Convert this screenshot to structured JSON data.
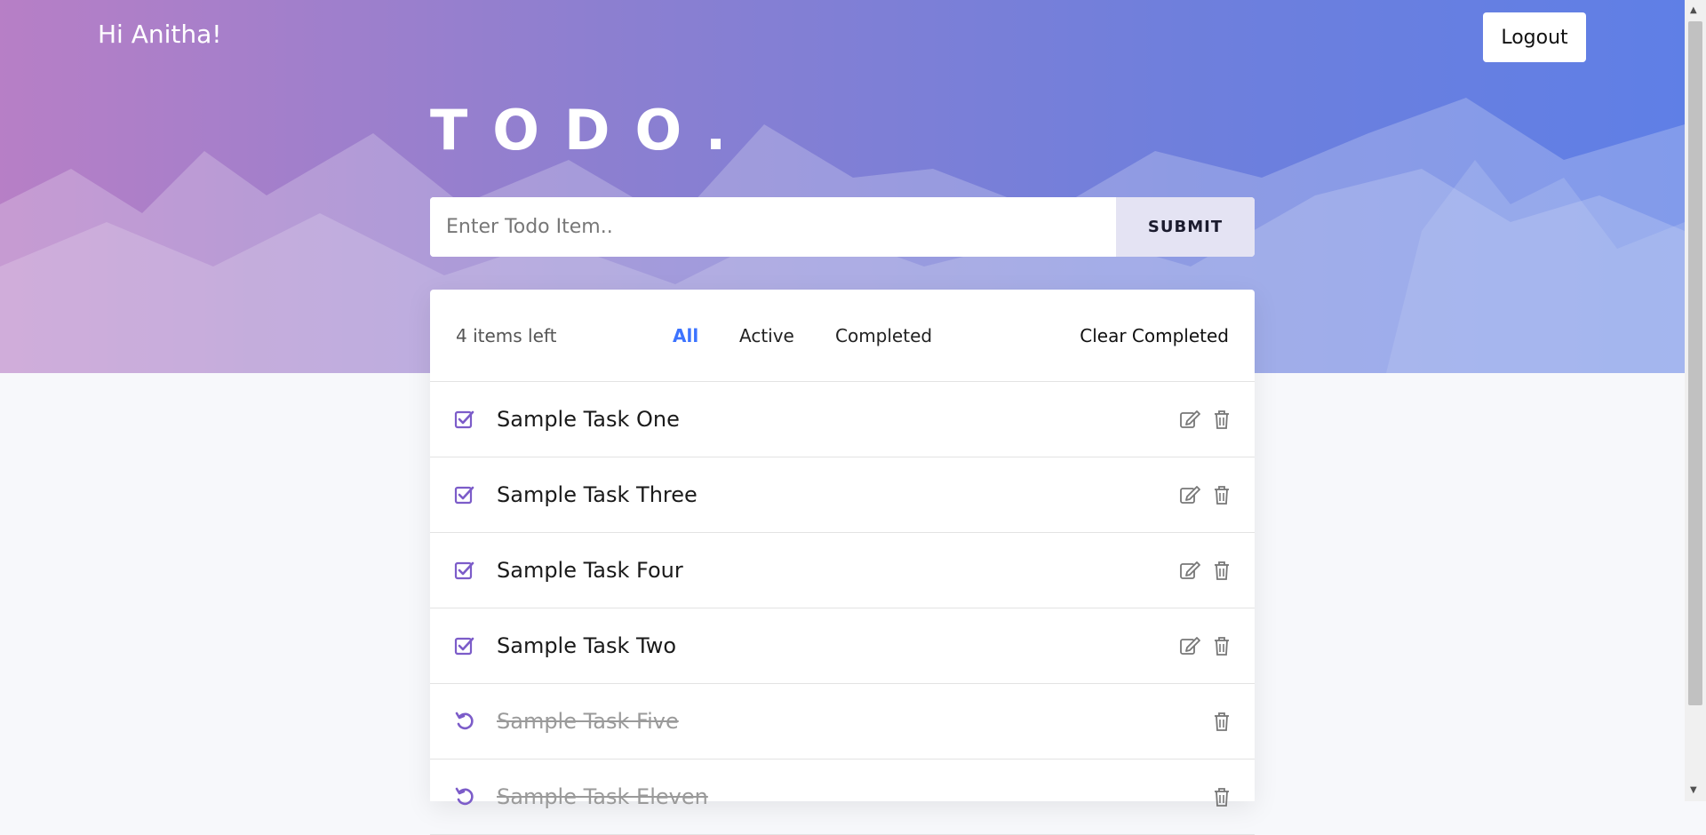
{
  "header": {
    "greeting": "Hi Anitha!",
    "logout_label": "Logout",
    "title": "TODO."
  },
  "entry": {
    "placeholder": "Enter Todo Item..",
    "submit_label": "SUBMIT"
  },
  "filters": {
    "items_left": "4 items left",
    "all": "All",
    "active": "Active",
    "completed": "Completed",
    "clear": "Clear Completed",
    "selected": "All"
  },
  "todos": [
    {
      "text": "Sample Task One",
      "completed": false
    },
    {
      "text": "Sample Task Three",
      "completed": false
    },
    {
      "text": "Sample Task Four",
      "completed": false
    },
    {
      "text": "Sample Task Two",
      "completed": false
    },
    {
      "text": "Sample Task Five",
      "completed": true
    },
    {
      "text": "Sample Task Eleven",
      "completed": true
    }
  ],
  "colors": {
    "accent": "#7c5cc9",
    "filter_active": "#3c73ff"
  },
  "icons": {
    "check": "check-square-icon",
    "undo": "undo-icon",
    "edit": "edit-icon",
    "delete": "trash-icon"
  }
}
